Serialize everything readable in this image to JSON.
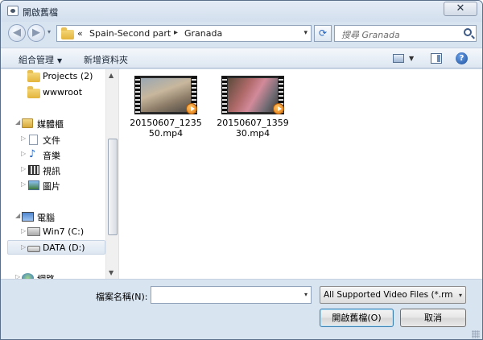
{
  "window": {
    "title": "開啟舊檔",
    "close_label": "✕"
  },
  "nav": {
    "back_glyph": "◀",
    "forward_glyph": "▶",
    "history_glyph": "▾",
    "address": {
      "prefix": "«",
      "segments": [
        "Spain-Second part",
        "Granada"
      ],
      "separator": "▸",
      "dropdown_glyph": "▾"
    },
    "refresh_glyph": "⟳",
    "search_placeholder": "搜尋 Granada"
  },
  "command_bar": {
    "organize_label": "組合管理",
    "organize_arrow": "▼",
    "new_folder_label": "新增資料夾",
    "view_arrow": "▼",
    "help_label": "?"
  },
  "nav_pane": {
    "items": [
      {
        "label": "Projects (2)",
        "icon": "folder-icon",
        "indent": 1
      },
      {
        "label": "wwwroot",
        "icon": "folder-icon",
        "indent": 1
      },
      {
        "label": "媒體櫃",
        "icon": "library-icon",
        "indent": 0,
        "expanded": true
      },
      {
        "label": "文件",
        "icon": "document-icon",
        "indent": 1
      },
      {
        "label": "音樂",
        "icon": "music-icon",
        "indent": 1
      },
      {
        "label": "視訊",
        "icon": "video-icon",
        "indent": 1
      },
      {
        "label": "圖片",
        "icon": "picture-icon",
        "indent": 1
      },
      {
        "label": "電腦",
        "icon": "computer-icon",
        "indent": 0,
        "expanded": true
      },
      {
        "label": "Win7 (C:)",
        "icon": "windows-drive-icon",
        "indent": 1
      },
      {
        "label": "DATA (D:)",
        "icon": "drive-icon",
        "indent": 1,
        "selected": true
      },
      {
        "label": "網路",
        "icon": "network-icon",
        "indent": 0
      }
    ],
    "scroll_up_glyph": "▲",
    "scroll_down_glyph": "▼"
  },
  "files": [
    {
      "name": "20150607_123550.mp4",
      "line1": "20150607_1235",
      "line2": "50.mp4",
      "icon": "video-thumbnail"
    },
    {
      "name": "20150607_135930.mp4",
      "line1": "20150607_1359",
      "line2": "30.mp4",
      "icon": "video-thumbnail"
    }
  ],
  "bottom": {
    "filename_label": "檔案名稱(N):",
    "filename_value": "",
    "filename_dropdown_glyph": "▾",
    "filetype_value": "All Supported Video Files (*.rm;*.",
    "filetype_dropdown_glyph": "▾",
    "open_label": "開啟舊檔(O)",
    "cancel_label": "取消"
  }
}
